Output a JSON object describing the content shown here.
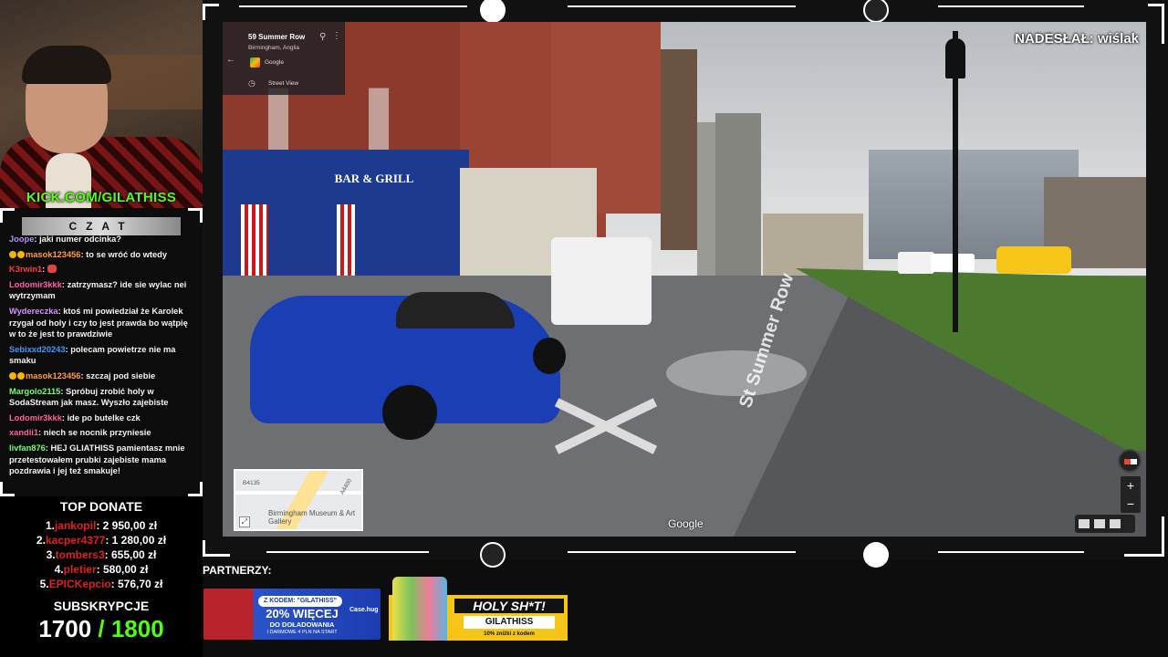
{
  "webcam": {
    "kick_url": "KICK.COM/GILATHISS"
  },
  "chat": {
    "title": "CZAT",
    "messages": [
      {
        "user": "Joope",
        "text": "jaki numer odcinka?",
        "color": "#b48cff",
        "badges": 0
      },
      {
        "user": "masok123456",
        "text": "to se wróć do wtedy",
        "color": "#ff9c3b",
        "badges": 2
      },
      {
        "user": "K3rwin1",
        "text": "",
        "color": "#ff3b3b",
        "badges": 0,
        "emote": true
      },
      {
        "user": "Lodomir3kkk",
        "text": "zatrzymasz? ide sie wylac nei wytrzymam",
        "color": "#ff5fa0",
        "badges": 0
      },
      {
        "user": "Wydereczka",
        "text": "ktoś mi powiedział że Karolek rzygał od holy i czy to jest prawda bo wątpię w to że jest to prawdziwie",
        "color": "#d890ff",
        "badges": 0
      },
      {
        "user": "Sebixxd20243",
        "text": "polecam powietrze nie ma smaku",
        "color": "#3b9cff",
        "badges": 0
      },
      {
        "user": "masok123456",
        "text": "szczaj pod siebie",
        "color": "#ff9c3b",
        "badges": 2
      },
      {
        "user": "Margolo2115",
        "text": "Spróbuj zrobić holy w SodaStream jak masz. Wyszło zajebiste",
        "color": "#6bff6b",
        "badges": 0
      },
      {
        "user": "Lodomir3kkk",
        "text": "ide po butelke czk",
        "color": "#ff5fa0",
        "badges": 0
      },
      {
        "user": "xandii1",
        "text": "niech se nocnik przyniesie",
        "color": "#ff5fa0",
        "badges": 0
      },
      {
        "user": "livfan876",
        "text": "HEJ GLIATHISS pamientasz mnie przetestowałem prubki zajebiste mama pozdrawia i jej też smakuje!",
        "color": "#6bff6b",
        "badges": 0
      }
    ]
  },
  "top_donate": {
    "title": "TOP DONATE",
    "entries": [
      {
        "rank": "1.",
        "name": "jankopil",
        "amount": "2 950,00 zł"
      },
      {
        "rank": "2.",
        "name": "kacper4377",
        "amount": "1 280,00 zł"
      },
      {
        "rank": "3.",
        "name": "tombers3",
        "amount": "655,00 zł"
      },
      {
        "rank": "4.",
        "name": "pletier",
        "amount": "580,00 zł"
      },
      {
        "rank": "5.",
        "name": "EPICKepcio",
        "amount": "576,70 zł"
      }
    ]
  },
  "subs": {
    "title": "SUBSKRYPCJE",
    "current": "1700",
    "goal": "/ 1800"
  },
  "streetview": {
    "submitted_by": "NADESŁAŁ: wiślak",
    "address": "59 Summer Row",
    "city": "Birmingham, Anglia",
    "provider": "Google",
    "mode": "Street View",
    "street_marking": "St Summer Row",
    "watermark": "Google",
    "minimap": {
      "road_label": "B4135",
      "poi": "Birmingham Museum & Art Gallery",
      "road2": "A4400"
    },
    "shop_sign": "BAR & GRILL",
    "zoom_in": "+",
    "zoom_out": "−"
  },
  "partners": {
    "label": "PARTNERZY:",
    "case": {
      "code": "Z KODEM: \"GILATHISS\"",
      "headline": "20% WIĘCEJ",
      "line2": "DO DOŁADOWANIA",
      "line3": "I DARMOWE 4 PLN NA START",
      "brand": "Case.hug"
    },
    "holy": {
      "headline": "HOLY SH*T!",
      "code": "GILATHISS",
      "note": "10% zniżki z kodem"
    }
  }
}
